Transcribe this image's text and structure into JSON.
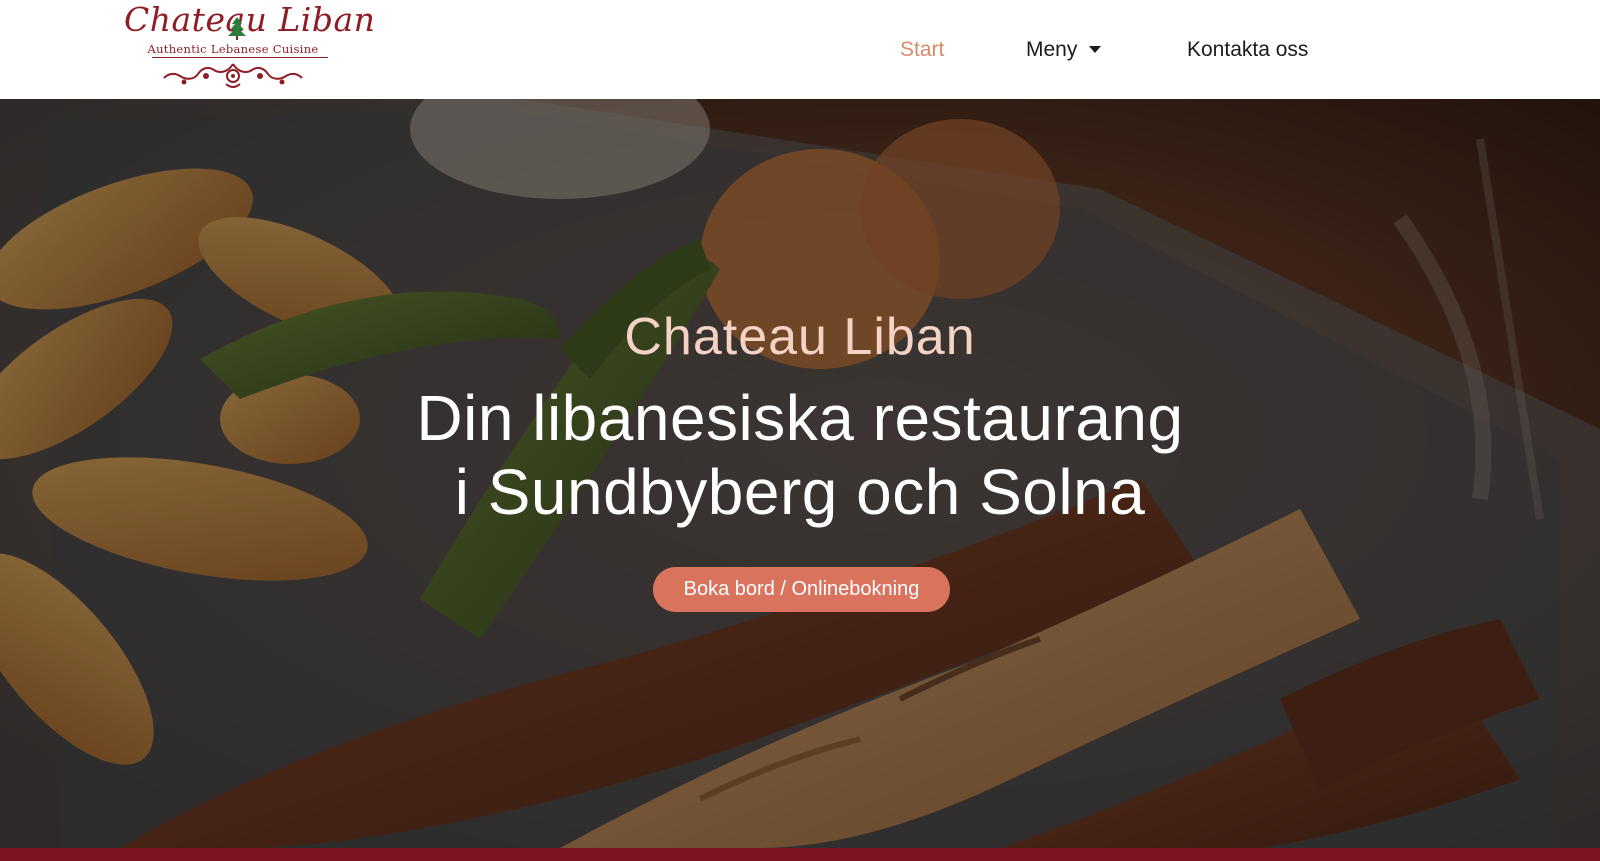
{
  "brand": {
    "name": "Chateau Liban",
    "tagline": "Authentic Lebanese Cuisine"
  },
  "nav": {
    "items": [
      {
        "label": "Start",
        "active": true
      },
      {
        "label": "Meny",
        "has_dropdown": true
      },
      {
        "label": "Kontakta oss"
      }
    ]
  },
  "hero": {
    "eyebrow": "Chateau Liban",
    "title_line_1": "Din libanesiska restaurang",
    "title_line_2": "i Sundbyberg och Solna",
    "cta_label": "Boka bord / Onlinebokning"
  },
  "colors": {
    "brand_red": "#8f1d26",
    "accent": "#d9735e",
    "active_nav": "#d98a68",
    "bottom_bar": "#7a1420"
  }
}
